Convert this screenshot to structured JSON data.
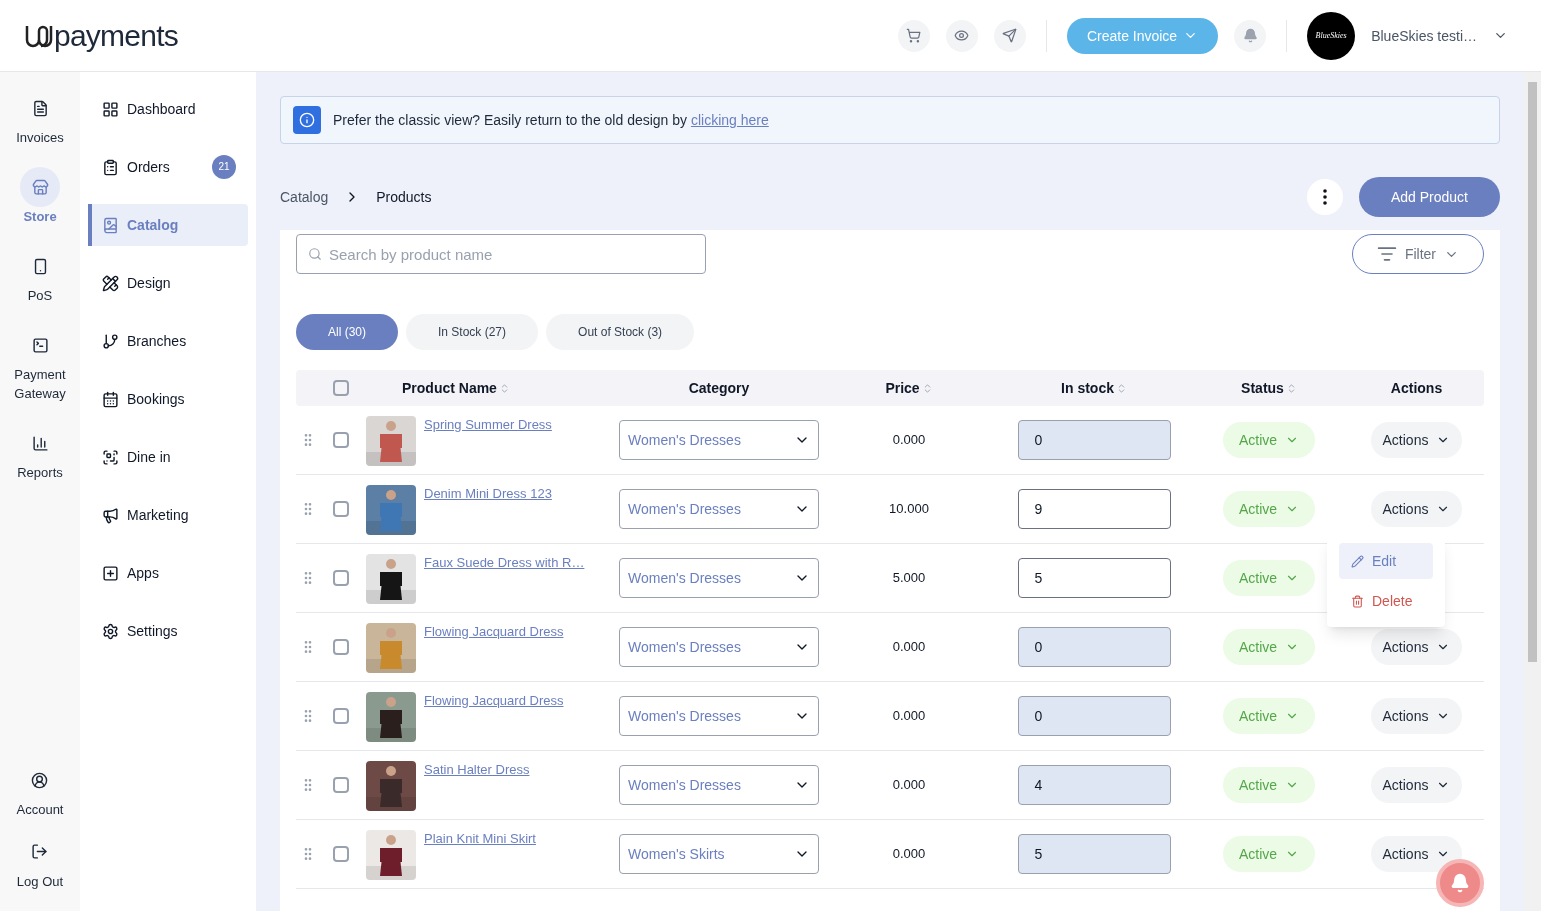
{
  "header": {
    "logo": "payments",
    "create_invoice": "Create Invoice",
    "account_name": "BlueSkies testi…",
    "avatar_text": "BlueSkies"
  },
  "rail": [
    {
      "label": "Invoices",
      "selected": false
    },
    {
      "label": "Store",
      "selected": true
    },
    {
      "label": "PoS",
      "selected": false
    },
    {
      "label": "Payment Gateway",
      "selected": false
    },
    {
      "label": "Reports",
      "selected": false
    }
  ],
  "rail_bottom": [
    {
      "label": "Account"
    },
    {
      "label": "Log Out"
    }
  ],
  "sidebar": [
    {
      "label": "Dashboard",
      "selected": false
    },
    {
      "label": "Orders",
      "selected": false,
      "badge": "21"
    },
    {
      "label": "Catalog",
      "selected": true
    },
    {
      "label": "Design",
      "selected": false
    },
    {
      "label": "Branches",
      "selected": false
    },
    {
      "label": "Bookings",
      "selected": false
    },
    {
      "label": "Dine in",
      "selected": false
    },
    {
      "label": "Marketing",
      "selected": false
    },
    {
      "label": "Apps",
      "selected": false
    },
    {
      "label": "Settings",
      "selected": false
    }
  ],
  "notice": {
    "text": "Prefer the classic view? Easily return to the old design by",
    "link": "clicking here"
  },
  "breadcrumb": [
    "Catalog",
    "Products"
  ],
  "add_product": "Add Product",
  "search": {
    "placeholder": "Search by product name"
  },
  "filter": "Filter",
  "stock_tabs": [
    {
      "label": "All (30)",
      "selected": true
    },
    {
      "label": "In Stock (27)",
      "selected": false
    },
    {
      "label": "Out of Stock (3)",
      "selected": false
    }
  ],
  "table": {
    "select_all": {
      "checked": false
    },
    "columns": [
      {
        "label": "Product Name",
        "sortable": true
      },
      {
        "label": "Category",
        "sortable": false
      },
      {
        "label": "Price",
        "sortable": true
      },
      {
        "label": "In stock",
        "sortable": true
      },
      {
        "label": "Status",
        "sortable": true
      },
      {
        "label": "Actions",
        "sortable": false
      }
    ],
    "rows": [
      {
        "name": "Spring Summer Dress",
        "category": "Women's Dresses",
        "price": "0.000",
        "stock": "0",
        "stock_shaded": true,
        "status": "Active",
        "actions": "Actions",
        "menu_open": false,
        "checked": false
      },
      {
        "name": "Denim Mini Dress 123",
        "category": "Women's Dresses",
        "price": "10.000",
        "stock": "9",
        "stock_shaded": false,
        "status": "Active",
        "actions": "Actions",
        "menu_open": true,
        "checked": false
      },
      {
        "name": "Faux Suede Dress with R…",
        "category": "Women's Dresses",
        "price": "5.000",
        "stock": "5",
        "stock_shaded": false,
        "status": "Active",
        "menu_open": false,
        "checked": false
      },
      {
        "name": "Flowing Jacquard Dress",
        "category": "Women's Dresses",
        "price": "0.000",
        "stock": "0",
        "stock_shaded": true,
        "status": "Active",
        "actions": "Actions",
        "menu_open": false,
        "checked": false
      },
      {
        "name": "Flowing Jacquard Dress",
        "category": "Women's Dresses",
        "price": "0.000",
        "stock": "0",
        "stock_shaded": true,
        "status": "Active",
        "actions": "Actions",
        "menu_open": false,
        "checked": false
      },
      {
        "name": "Satin Halter Dress",
        "category": "Women's Dresses",
        "price": "0.000",
        "stock": "4",
        "stock_shaded": true,
        "status": "Active",
        "actions": "Actions",
        "menu_open": false,
        "checked": false
      },
      {
        "name": "Plain Knit Mini Skirt",
        "category": "Women's Skirts",
        "price": "0.000",
        "stock": "5",
        "stock_shaded": true,
        "status": "Active",
        "actions": "Actions",
        "menu_open": false,
        "checked": false
      }
    ]
  },
  "actions_menu": {
    "items": [
      {
        "label": "Edit",
        "kind": "edit",
        "selected": true
      },
      {
        "label": "Delete",
        "kind": "delete",
        "selected": false
      }
    ]
  }
}
